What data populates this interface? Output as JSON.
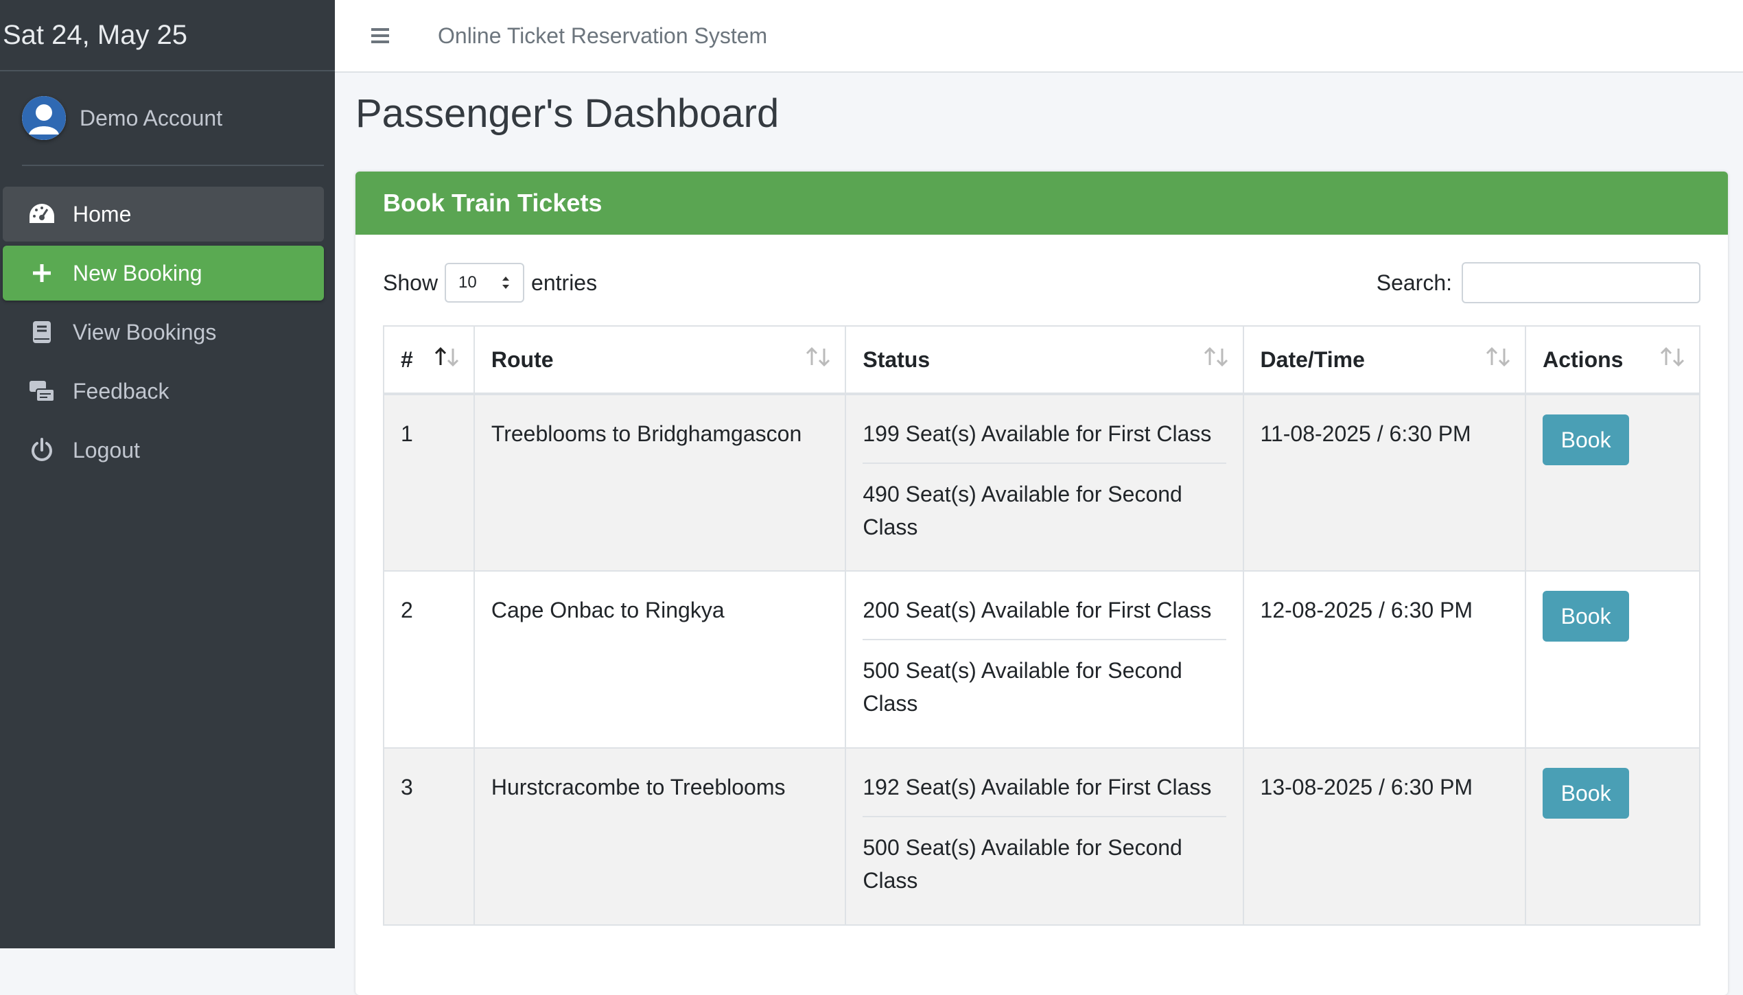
{
  "sidebar": {
    "date": "Sat 24, May 25",
    "user": "Demo Account",
    "items": [
      {
        "label": "Home",
        "icon": "dashboard-icon"
      },
      {
        "label": "New Booking",
        "icon": "plus-icon"
      },
      {
        "label": "View Bookings",
        "icon": "book-icon"
      },
      {
        "label": "Feedback",
        "icon": "feedback-icon"
      },
      {
        "label": "Logout",
        "icon": "power-icon"
      }
    ]
  },
  "topbar": {
    "title": "Online Ticket Reservation System"
  },
  "page": {
    "title": "Passenger's Dashboard"
  },
  "card": {
    "header": "Book Train Tickets",
    "show_label": "Show",
    "entries_value": "10",
    "entries_label": "entries",
    "search_label": "Search:",
    "search_value": ""
  },
  "table": {
    "columns": [
      "#",
      "Route",
      "Status",
      "Date/Time",
      "Actions"
    ],
    "rows": [
      {
        "num": "1",
        "route": "Treeblooms to Bridghamgascon",
        "first": "199 Seat(s) Available for First Class",
        "second": "490 Seat(s) Available for Second Class",
        "datetime": "11-08-2025 / 6:30 PM",
        "action": "Book"
      },
      {
        "num": "2",
        "route": "Cape Onbac to Ringkya",
        "first": "200 Seat(s) Available for First Class",
        "second": "500 Seat(s) Available for Second Class",
        "datetime": "12-08-2025 / 6:30 PM",
        "action": "Book"
      },
      {
        "num": "3",
        "route": "Hurstcracombe to Treeblooms",
        "first": "192 Seat(s) Available for First Class",
        "second": "500 Seat(s) Available for Second Class",
        "datetime": "13-08-2025 / 6:30 PM",
        "action": "Book"
      }
    ]
  },
  "colors": {
    "sidebar": "#343a40",
    "success": "#5aa552",
    "info": "#4a9fb5"
  }
}
